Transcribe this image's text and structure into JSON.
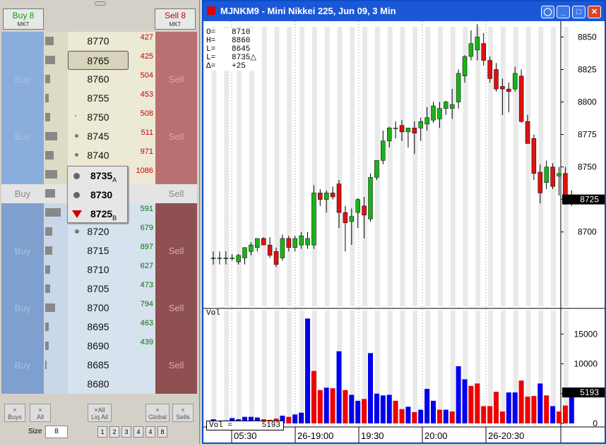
{
  "ladder": {
    "buy_mkt": {
      "label": "Buy 8",
      "sub": "MKT"
    },
    "sell_mkt": {
      "label": "Sell 8",
      "sub": "MKT"
    },
    "rows": [
      {
        "price": "8770",
        "qty": "427",
        "side": "ask",
        "vol": 0.5
      },
      {
        "price": "8765",
        "qty": "425",
        "side": "ask",
        "vol": 0.6,
        "selected": true
      },
      {
        "price": "8760",
        "qty": "504",
        "side": "ask",
        "vol": 0.3,
        "buy": "Buy",
        "sell": "Sell"
      },
      {
        "price": "8755",
        "qty": "453",
        "side": "ask",
        "vol": 0.2
      },
      {
        "price": "8750",
        "qty": "508",
        "side": "ask",
        "vol": 0.3
      },
      {
        "price": "8745",
        "qty": "511",
        "side": "ask",
        "vol": 0.7,
        "buy": "Buy",
        "sell": "Sell"
      },
      {
        "price": "8740",
        "qty": "971",
        "side": "ask",
        "vol": 0.5
      },
      {
        "price": "8735",
        "qty": "1086",
        "side": "ask",
        "vol": 0.7
      },
      {
        "price": "8730",
        "qty": "",
        "side": "mid",
        "vol": 0.6,
        "buy": "Buy",
        "sell": "Sell"
      },
      {
        "price": "8725",
        "qty": "591",
        "side": "bid",
        "vol": 0.9
      },
      {
        "price": "8720",
        "qty": "679",
        "side": "bid",
        "vol": 0.4
      },
      {
        "price": "8715",
        "qty": "897",
        "side": "bid",
        "vol": 0.4,
        "buy": "Buy",
        "sell": "Sell"
      },
      {
        "price": "8710",
        "qty": "627",
        "side": "bid",
        "vol": 0.3
      },
      {
        "price": "8705",
        "qty": "473",
        "side": "bid",
        "vol": 0.3
      },
      {
        "price": "8700",
        "qty": "794",
        "side": "bid",
        "vol": 0.6,
        "buy": "Buy",
        "sell": "Sell"
      },
      {
        "price": "8695",
        "qty": "463",
        "side": "bid",
        "vol": 0.2
      },
      {
        "price": "8690",
        "qty": "439",
        "side": "bid",
        "vol": 0.2
      },
      {
        "price": "8685",
        "qty": "",
        "side": "bid",
        "vol": 0.1,
        "buy": "Buy",
        "sell": "Sell"
      },
      {
        "price": "8680",
        "qty": "",
        "side": "bid",
        "vol": 0
      }
    ],
    "popup": [
      {
        "price": "8735",
        "sub": "A"
      },
      {
        "price": "8730",
        "sub": ""
      },
      {
        "price": "8725",
        "sub": "B"
      }
    ],
    "buttons": {
      "buys": "Buys",
      "all": "All",
      "liq_all": "Liq All",
      "global": "Global",
      "sells": "Sells",
      "x": "×"
    },
    "size_label": "Size",
    "size_value": "8",
    "qty_buttons": [
      "1",
      "2",
      "3",
      "4",
      "4",
      "8"
    ]
  },
  "window": {
    "title": "MJNKM9 - Mini Nikkei 225, Jun 09, 3 Min",
    "buttons": [
      "◯",
      "_",
      "□",
      "✕"
    ]
  },
  "ohlc": {
    "rows": [
      {
        "label": "O=",
        "value": "8710"
      },
      {
        "label": "H=",
        "value": "8860"
      },
      {
        "label": "L=",
        "value": "8645"
      },
      {
        "label": "L=",
        "value": "8735△"
      },
      {
        "label": "Δ=",
        "value": "+25"
      }
    ]
  },
  "volume_label": "Vol",
  "volume_box": {
    "label": "Vol =",
    "value": "5193"
  },
  "last_price_tag": "8725",
  "last_volume_tag": "5193",
  "chart_data": {
    "type": "candlestick",
    "price_axis": {
      "ticks": [
        8850,
        8825,
        8800,
        8775,
        8750,
        8725,
        8700
      ],
      "ylim": [
        8645,
        8860
      ]
    },
    "volume_axis": {
      "ticks": [
        15000,
        10000,
        5000,
        0
      ],
      "ylim": [
        0,
        18000
      ]
    },
    "time_labels": [
      "05:30",
      "26-19:00",
      "19:30",
      "20:00",
      "26-20:30"
    ],
    "candles": [
      {
        "o": 8680,
        "h": 8685,
        "l": 8675,
        "c": 8680
      },
      {
        "o": 8680,
        "h": 8685,
        "l": 8675,
        "c": 8680
      },
      {
        "o": 8680,
        "h": 8685,
        "l": 8675,
        "c": 8680
      },
      {
        "o": 8680,
        "h": 8683,
        "l": 8678,
        "c": 8680
      },
      {
        "o": 8677,
        "h": 8683,
        "l": 8675,
        "c": 8682
      },
      {
        "o": 8680,
        "h": 8688,
        "l": 8675,
        "c": 8688
      },
      {
        "o": 8685,
        "h": 8692,
        "l": 8682,
        "c": 8690
      },
      {
        "o": 8688,
        "h": 8695,
        "l": 8685,
        "c": 8695
      },
      {
        "o": 8695,
        "h": 8696,
        "l": 8690,
        "c": 8690
      },
      {
        "o": 8690,
        "h": 8696,
        "l": 8680,
        "c": 8682
      },
      {
        "o": 8685,
        "h": 8688,
        "l": 8673,
        "c": 8675
      },
      {
        "o": 8680,
        "h": 8698,
        "l": 8678,
        "c": 8695
      },
      {
        "o": 8695,
        "h": 8697,
        "l": 8685,
        "c": 8688
      },
      {
        "o": 8688,
        "h": 8697,
        "l": 8685,
        "c": 8695
      },
      {
        "o": 8690,
        "h": 8700,
        "l": 8687,
        "c": 8697
      },
      {
        "o": 8690,
        "h": 8700,
        "l": 8687,
        "c": 8695
      },
      {
        "o": 8690,
        "h": 8736,
        "l": 8687,
        "c": 8730
      },
      {
        "o": 8730,
        "h": 8733,
        "l": 8720,
        "c": 8725
      },
      {
        "o": 8725,
        "h": 8732,
        "l": 8715,
        "c": 8730
      },
      {
        "o": 8730,
        "h": 8735,
        "l": 8725,
        "c": 8727
      },
      {
        "o": 8737,
        "h": 8740,
        "l": 8703,
        "c": 8715
      },
      {
        "o": 8715,
        "h": 8720,
        "l": 8685,
        "c": 8707
      },
      {
        "o": 8708,
        "h": 8718,
        "l": 8690,
        "c": 8712
      },
      {
        "o": 8715,
        "h": 8726,
        "l": 8703,
        "c": 8725
      },
      {
        "o": 8720,
        "h": 8727,
        "l": 8695,
        "c": 8713
      },
      {
        "o": 8710,
        "h": 8745,
        "l": 8708,
        "c": 8742
      },
      {
        "o": 8742,
        "h": 8755,
        "l": 8740,
        "c": 8755
      },
      {
        "o": 8755,
        "h": 8778,
        "l": 8752,
        "c": 8770
      },
      {
        "o": 8770,
        "h": 8781,
        "l": 8765,
        "c": 8780
      },
      {
        "o": 8780,
        "h": 8785,
        "l": 8772,
        "c": 8780
      },
      {
        "o": 8782,
        "h": 8786,
        "l": 8770,
        "c": 8777
      },
      {
        "o": 8777,
        "h": 8780,
        "l": 8765,
        "c": 8780
      },
      {
        "o": 8780,
        "h": 8785,
        "l": 8760,
        "c": 8776
      },
      {
        "o": 8780,
        "h": 8788,
        "l": 8770,
        "c": 8785
      },
      {
        "o": 8783,
        "h": 8796,
        "l": 8778,
        "c": 8788
      },
      {
        "o": 8786,
        "h": 8800,
        "l": 8784,
        "c": 8797
      },
      {
        "o": 8787,
        "h": 8800,
        "l": 8780,
        "c": 8795
      },
      {
        "o": 8795,
        "h": 8801,
        "l": 8790,
        "c": 8800
      },
      {
        "o": 8795,
        "h": 8810,
        "l": 8787,
        "c": 8798
      },
      {
        "o": 8800,
        "h": 8825,
        "l": 8795,
        "c": 8822
      },
      {
        "o": 8820,
        "h": 8836,
        "l": 8815,
        "c": 8835
      },
      {
        "o": 8835,
        "h": 8855,
        "l": 8832,
        "c": 8845
      },
      {
        "o": 8840,
        "h": 8860,
        "l": 8832,
        "c": 8850
      },
      {
        "o": 8845,
        "h": 8853,
        "l": 8828,
        "c": 8832
      },
      {
        "o": 8832,
        "h": 8835,
        "l": 8815,
        "c": 8818
      },
      {
        "o": 8825,
        "h": 8830,
        "l": 8808,
        "c": 8810
      },
      {
        "o": 8812,
        "h": 8818,
        "l": 8790,
        "c": 8810
      },
      {
        "o": 8810,
        "h": 8815,
        "l": 8792,
        "c": 8808
      },
      {
        "o": 8810,
        "h": 8827,
        "l": 8808,
        "c": 8822
      },
      {
        "o": 8820,
        "h": 8825,
        "l": 8784,
        "c": 8785
      },
      {
        "o": 8785,
        "h": 8790,
        "l": 8768,
        "c": 8768
      },
      {
        "o": 8772,
        "h": 8775,
        "l": 8740,
        "c": 8745
      },
      {
        "o": 8746,
        "h": 8752,
        "l": 8722,
        "c": 8730
      },
      {
        "o": 8738,
        "h": 8755,
        "l": 8733,
        "c": 8750
      },
      {
        "o": 8750,
        "h": 8753,
        "l": 8733,
        "c": 8735
      },
      {
        "o": 8743,
        "h": 8750,
        "l": 8728,
        "c": 8745
      },
      {
        "o": 8745,
        "h": 8750,
        "l": 8721,
        "c": 8727
      },
      {
        "o": 8726,
        "h": 8732,
        "l": 8720,
        "c": 8725
      }
    ],
    "volumes": [
      700,
      200,
      500,
      900,
      700,
      1100,
      1100,
      1000,
      700,
      600,
      800,
      1300,
      1100,
      1500,
      1800,
      17600,
      8800,
      5600,
      6000,
      5900,
      12100,
      5600,
      4800,
      3800,
      4100,
      11800,
      5000,
      4700,
      4800,
      3800,
      2400,
      2800,
      1900,
      2300,
      5800,
      3800,
      2300,
      2300,
      2000,
      9600,
      7400,
      6300,
      6700,
      2900,
      2900,
      5300,
      2000,
      5200,
      5200,
      7200,
      4500,
      4600,
      6700,
      4700,
      2900,
      2000,
      3000,
      5193
    ],
    "volume_up": [
      true,
      false,
      true,
      true,
      true,
      true,
      true,
      true,
      false,
      false,
      false,
      true,
      false,
      true,
      true,
      true,
      false,
      false,
      true,
      false,
      true,
      false,
      true,
      true,
      false,
      true,
      true,
      true,
      true,
      false,
      false,
      true,
      false,
      true,
      true,
      true,
      false,
      true,
      false,
      true,
      true,
      false,
      false,
      false,
      false,
      false,
      false,
      true,
      true,
      false,
      false,
      false,
      true,
      false,
      true,
      false,
      false,
      true
    ]
  }
}
